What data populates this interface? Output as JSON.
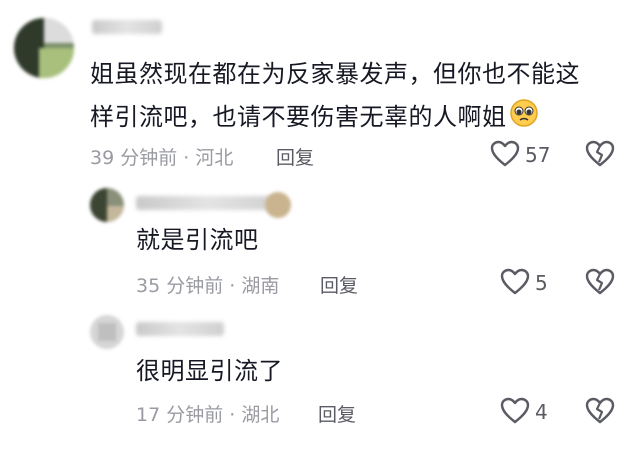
{
  "comments": [
    {
      "text_line1": "姐虽然现在都在为反家暴发声，但你也不能这",
      "text_line2": "样引流吧，也请不要伤害无辜的人啊姐",
      "emoji": "pleading-face",
      "time": "39 分钟前",
      "location": "河北",
      "reply_label": "回复",
      "likes": "57",
      "colors": {
        "text": "#161823",
        "meta": "#9a9ba2"
      }
    },
    {
      "text": "就是引流吧",
      "time": "35 分钟前",
      "location": "湖南",
      "reply_label": "回复",
      "likes": "5"
    },
    {
      "text": "很明显引流了",
      "time": "17 分钟前",
      "location": "湖北",
      "reply_label": "回复",
      "likes": "4"
    }
  ],
  "separator": " · ",
  "icons": {
    "like": "heart-outline-icon",
    "dislike": "broken-heart-icon"
  }
}
